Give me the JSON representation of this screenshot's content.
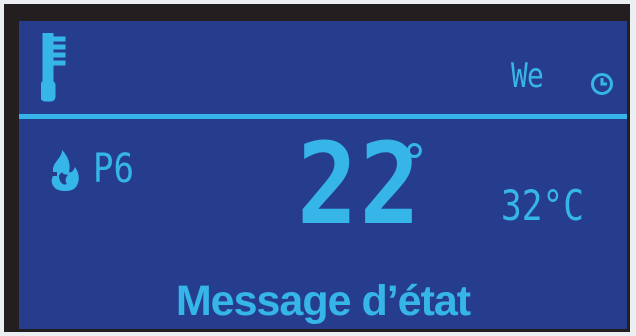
{
  "colors": {
    "screen_background": "#253d8c",
    "accent": "#36b6e8",
    "frame": "#231f20"
  },
  "header": {
    "mode_icon": "thermometer-icon",
    "day": "We",
    "clock_icon": "clock-icon"
  },
  "main": {
    "heating_icon": "flame-icon",
    "program": "P6",
    "room_temperature": "22",
    "room_temperature_unit": "°",
    "outside_temperature": "32°C"
  },
  "footer": {
    "status_message": "Message d’état"
  }
}
